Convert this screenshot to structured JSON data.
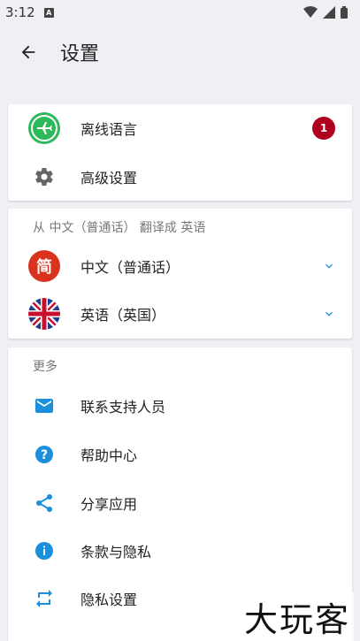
{
  "status_bar": {
    "time": "3:12",
    "notif_icon_letter": "A"
  },
  "header": {
    "title": "设置"
  },
  "card_main": {
    "items": [
      {
        "label": "离线语言",
        "icon": "airplane-icon",
        "badge": "1"
      },
      {
        "label": "高级设置",
        "icon": "gear-icon"
      }
    ]
  },
  "translate": {
    "header": "从 中文（普通话） 翻译成 英语",
    "source": {
      "label": "中文（普通话）",
      "icon_text": "简"
    },
    "target": {
      "label": "英语（英国）",
      "icon": "uk-flag-icon"
    }
  },
  "more": {
    "header": "更多",
    "items": [
      {
        "label": "联系支持人员",
        "icon": "mail-icon"
      },
      {
        "label": "帮助中心",
        "icon": "help-icon"
      },
      {
        "label": "分享应用",
        "icon": "share-icon"
      },
      {
        "label": "条款与隐私",
        "icon": "info-icon"
      },
      {
        "label": "隐私设置",
        "icon": "repeat-icon"
      }
    ]
  },
  "watermark": "大玩客",
  "colors": {
    "accent": "#1a8fdc",
    "badge": "#b00020",
    "airplane_green": "#2db85a",
    "simp_red": "#d9331f"
  }
}
